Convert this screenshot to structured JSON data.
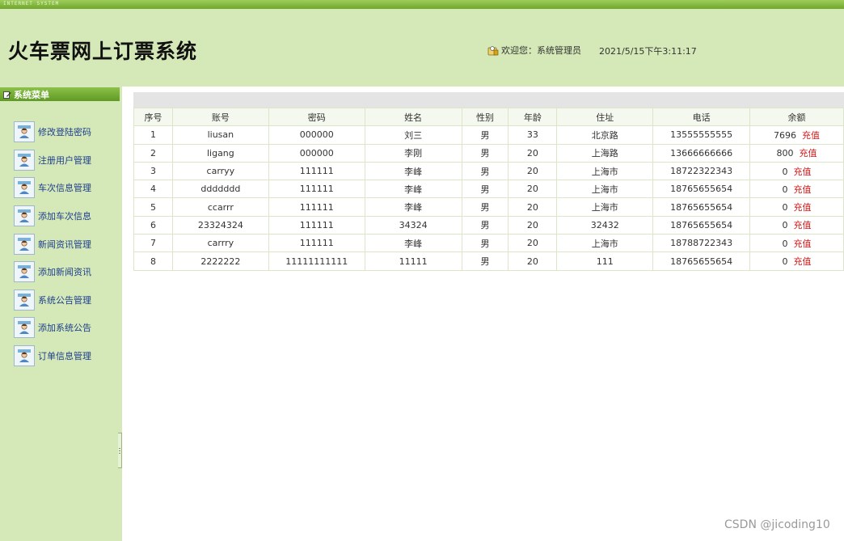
{
  "top_strip": {
    "text": "INTERNET SYSTEM"
  },
  "header": {
    "title": "火车票网上订票系统",
    "welcome": "欢迎您：系统管理员",
    "datetime": "2021/5/15下午3:11:17"
  },
  "sidebar": {
    "heading": "系统菜单",
    "items": [
      {
        "label": "修改登陆密码"
      },
      {
        "label": "注册用户管理"
      },
      {
        "label": "车次信息管理"
      },
      {
        "label": "添加车次信息"
      },
      {
        "label": "新闻资讯管理"
      },
      {
        "label": "添加新闻资讯"
      },
      {
        "label": "系统公告管理"
      },
      {
        "label": "添加系统公告"
      },
      {
        "label": "订单信息管理"
      }
    ]
  },
  "table": {
    "headers": [
      "序号",
      "账号",
      "密码",
      "姓名",
      "性别",
      "年龄",
      "住址",
      "电话",
      "余额"
    ],
    "recharge_label": "充值",
    "rows": [
      [
        "1",
        "liusan",
        "000000",
        "刘三",
        "男",
        "33",
        "北京路",
        "13555555555",
        "7696"
      ],
      [
        "2",
        "ligang",
        "000000",
        "李刚",
        "男",
        "20",
        "上海路",
        "13666666666",
        "800"
      ],
      [
        "3",
        "carryy",
        "111111",
        "李峰",
        "男",
        "20",
        "上海市",
        "18722322343",
        "0"
      ],
      [
        "4",
        "ddddddd",
        "111111",
        "李峰",
        "男",
        "20",
        "上海市",
        "18765655654",
        "0"
      ],
      [
        "5",
        "ccarrr",
        "111111",
        "李峰",
        "男",
        "20",
        "上海市",
        "18765655654",
        "0"
      ],
      [
        "6",
        "23324324",
        "111111",
        "34324",
        "男",
        "20",
        "32432",
        "18765655654",
        "0"
      ],
      [
        "7",
        "carrry",
        "111111",
        "李峰",
        "男",
        "20",
        "上海市",
        "18788722343",
        "0"
      ],
      [
        "8",
        "2222222",
        "11111111111",
        "11111",
        "男",
        "20",
        "111",
        "18765655654",
        "0"
      ]
    ]
  },
  "watermark": "CSDN @jicoding10"
}
